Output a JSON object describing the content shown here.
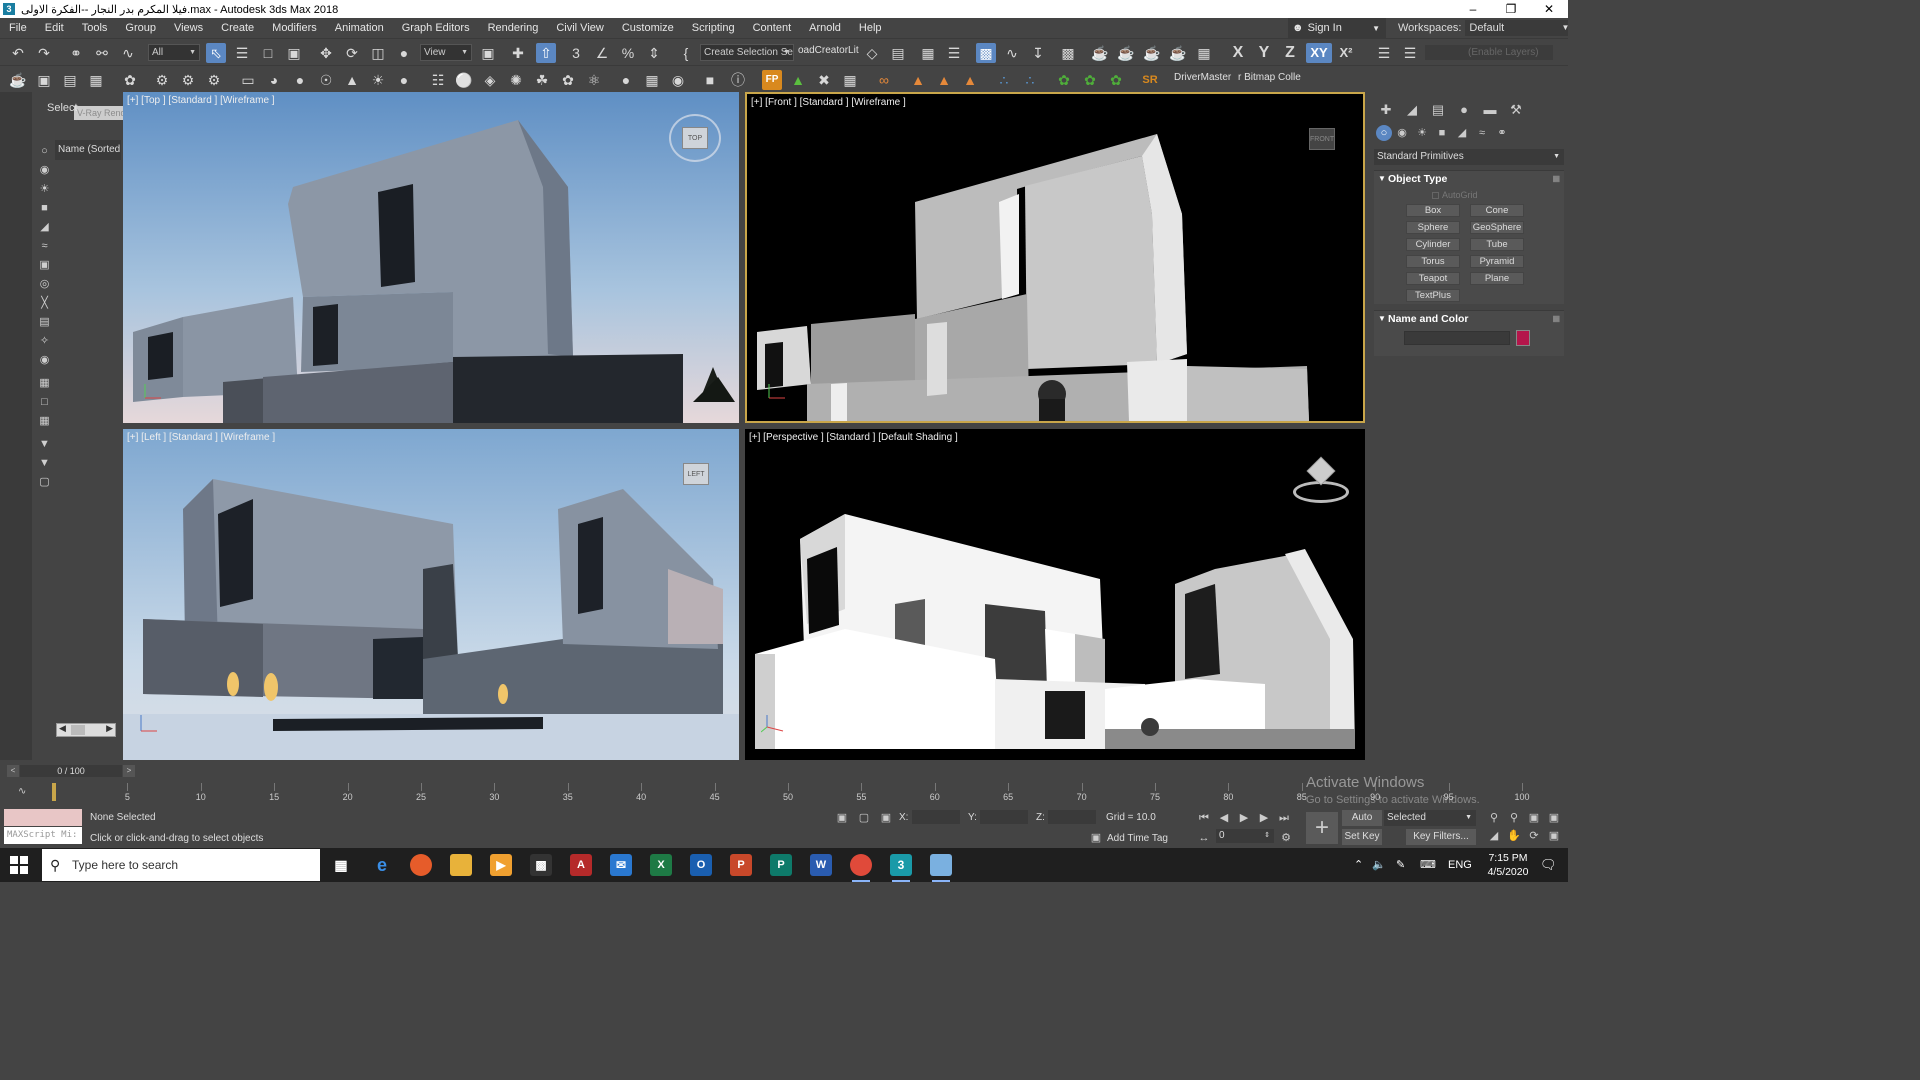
{
  "window": {
    "title": "فيلا المكرم بدر النجار --الفكرة الاولى.max - Autodesk 3ds Max 2018",
    "app_icon": "3",
    "minimize": "–",
    "maximize": "❐",
    "close": "✕"
  },
  "menu": [
    "File",
    "Edit",
    "Tools",
    "Group",
    "Views",
    "Create",
    "Modifiers",
    "Animation",
    "Graph Editors",
    "Rendering",
    "Civil View",
    "Customize",
    "Scripting",
    "Content",
    "Arnold",
    "Help"
  ],
  "account": {
    "sign_in": "Sign In",
    "workspaces_label": "Workspaces:",
    "workspace_value": "Default"
  },
  "toolbar1": {
    "selection_filter": "All",
    "ref_coord": "View",
    "named_selection": "Create Selection Se",
    "load_creator": "oadCreatorLit",
    "axis_x": "X",
    "axis_y": "Y",
    "axis_z": "Z",
    "axis_xy": "XY",
    "axis_xs": "X²",
    "enable_layers": "(Enable Layers)"
  },
  "toolbar2": {
    "fp": "FP",
    "sr": "SR",
    "driver_master": "DriverMaster",
    "bitmap_coll": "r Bitmap Colle"
  },
  "scene_explorer": {
    "select_label": "Select",
    "ghost_tip": "V-Ray Render Settings",
    "column": "Name (Sorted ↑"
  },
  "viewports": {
    "top": {
      "label": "[+] [Top ] [Standard ] [Wireframe ]",
      "cube": "TOP"
    },
    "front": {
      "label": "[+] [Front ] [Standard ] [Wireframe ]",
      "cube": "FRONT"
    },
    "left": {
      "label": "[+] [Left ] [Standard ] [Wireframe ]",
      "cube": "LEFT"
    },
    "persp": {
      "label": "[+] [Perspective ] [Standard ] [Default Shading ]"
    }
  },
  "command_panel": {
    "category": "Standard Primitives",
    "object_type_title": "Object Type",
    "autogrid": "AutoGrid",
    "buttons": [
      "Box",
      "Cone",
      "Sphere",
      "GeoSphere",
      "Cylinder",
      "Tube",
      "Torus",
      "Pyramid",
      "Teapot",
      "Plane",
      "TextPlus"
    ],
    "name_color_title": "Name and Color",
    "object_color": "#b4164b"
  },
  "timeline": {
    "frame_label": "0 / 100",
    "ticks": [
      "5",
      "10",
      "15",
      "20",
      "25",
      "30",
      "35",
      "40",
      "45",
      "50",
      "55",
      "60",
      "65",
      "70",
      "75",
      "80",
      "85",
      "90",
      "95",
      "100"
    ]
  },
  "status": {
    "maxscript_hint": "MAXScript Mi:",
    "selection": "None Selected",
    "prompt": "Click or click-and-drag to select objects",
    "x_label": "X:",
    "y_label": "Y:",
    "z_label": "Z:",
    "grid": "Grid = 10.0",
    "add_time_tag": "Add Time Tag",
    "auto_key": "Auto Key",
    "set_key": "Set Key",
    "key_mode": "Selected",
    "key_filters": "Key Filters...",
    "current_frame": "0"
  },
  "watermark": {
    "line1": "Activate Windows",
    "line2": "Go to Settings to activate Windows."
  },
  "taskbar": {
    "search_placeholder": "Type here to search",
    "language": "ENG",
    "time": "7:15 PM",
    "date": "4/5/2020"
  }
}
